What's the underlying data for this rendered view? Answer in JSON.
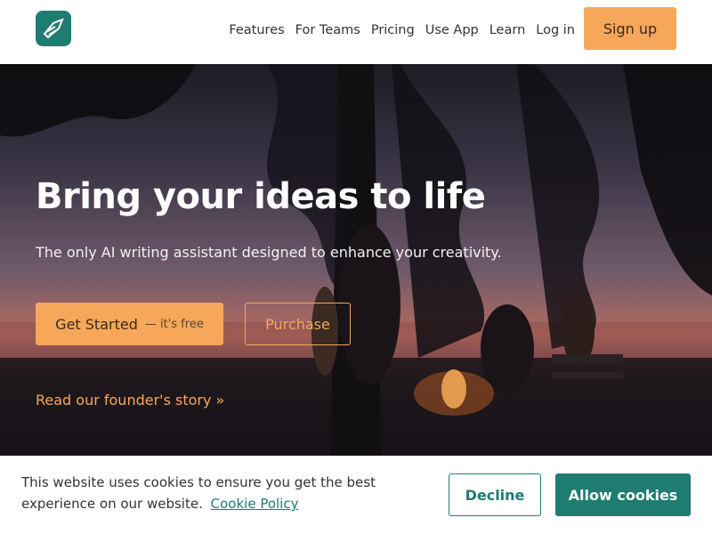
{
  "header": {
    "logo_icon": "quill-page-icon",
    "nav": [
      {
        "label": "Features"
      },
      {
        "label": "For Teams"
      },
      {
        "label": "Pricing"
      },
      {
        "label": "Use App"
      },
      {
        "label": "Learn"
      },
      {
        "label": "Log in"
      }
    ],
    "signup_label": "Sign up"
  },
  "hero": {
    "title": "Bring your ideas to life",
    "subtitle": "The only AI writing assistant designed to enhance your creativity.",
    "get_started_label": "Get Started",
    "get_started_note": "— it's free",
    "purchase_label": "Purchase",
    "founder_link": "Read our founder's story »"
  },
  "cookie": {
    "message": "This website uses cookies to ensure you get the best experience on our website.",
    "policy_link": "Cookie Policy",
    "decline_label": "Decline",
    "allow_label": "Allow cookies"
  },
  "colors": {
    "brand_teal": "#1f7c70",
    "accent_orange": "#f6a75a"
  }
}
